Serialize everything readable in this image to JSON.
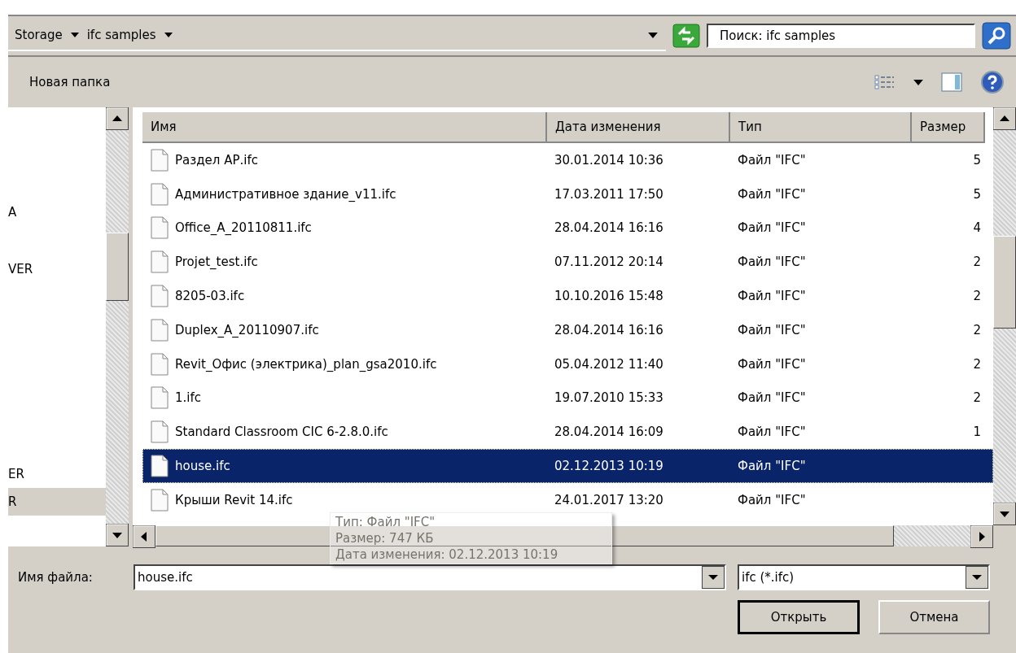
{
  "address": {
    "crumbs": [
      "Storage",
      "ifc samples"
    ]
  },
  "search": {
    "placeholder": "Поиск: ifc samples"
  },
  "toolbar": {
    "new_folder": "Новая папка"
  },
  "sidebar": {
    "items": [
      {
        "label": "A",
        "selected": false
      },
      {
        "label": "VER",
        "selected": false
      },
      {
        "label": "ER",
        "selected": false
      },
      {
        "label": "R",
        "selected": true
      }
    ]
  },
  "table": {
    "columns": [
      "Имя",
      "Дата изменения",
      "Тип",
      "Размер"
    ],
    "rows": [
      {
        "name": "Раздел АР.ifc",
        "date": "30.01.2014 10:36",
        "type": "Файл \"IFC\"",
        "size": "5",
        "selected": false
      },
      {
        "name": "Административное здание_v11.ifc",
        "date": "17.03.2011 17:50",
        "type": "Файл \"IFC\"",
        "size": "5",
        "selected": false
      },
      {
        "name": "Office_A_20110811.ifc",
        "date": "28.04.2014 16:16",
        "type": "Файл \"IFC\"",
        "size": "4",
        "selected": false
      },
      {
        "name": "Projet_test.ifc",
        "date": "07.11.2012 20:14",
        "type": "Файл \"IFC\"",
        "size": "2",
        "selected": false
      },
      {
        "name": "8205-03.ifc",
        "date": "10.10.2016 15:48",
        "type": "Файл \"IFC\"",
        "size": "2",
        "selected": false
      },
      {
        "name": "Duplex_A_20110907.ifc",
        "date": "28.04.2014 16:16",
        "type": "Файл \"IFC\"",
        "size": "2",
        "selected": false
      },
      {
        "name": "Revit_Офис (электрика)_plan_gsa2010.ifc",
        "date": "05.04.2012 11:40",
        "type": "Файл \"IFC\"",
        "size": "2",
        "selected": false
      },
      {
        "name": "1.ifc",
        "date": "19.07.2010 15:33",
        "type": "Файл \"IFC\"",
        "size": "2",
        "selected": false
      },
      {
        "name": "Standard Classroom CIC 6-2.8.0.ifc",
        "date": "28.04.2014 16:09",
        "type": "Файл \"IFC\"",
        "size": "1",
        "selected": false
      },
      {
        "name": "house.ifc",
        "date": "02.12.2013 10:19",
        "type": "Файл \"IFC\"",
        "selected": true
      },
      {
        "name": "Крыши Revit 14.ifc",
        "date": "24.01.2017 13:20",
        "type": "Файл \"IFC\"",
        "selected": false
      }
    ]
  },
  "tooltip": {
    "lines": [
      "Тип: Файл \"IFC\"",
      "Размер: 747 КБ",
      "Дата изменения: 02.12.2013 10:19"
    ]
  },
  "filename": {
    "label": "Имя файла:",
    "value": "house.ifc"
  },
  "filter": {
    "value": "ifc (*.ifc)"
  },
  "buttons": [
    {
      "label": "Открыть",
      "default": true
    },
    {
      "label": "Отмена",
      "default": false
    }
  ]
}
